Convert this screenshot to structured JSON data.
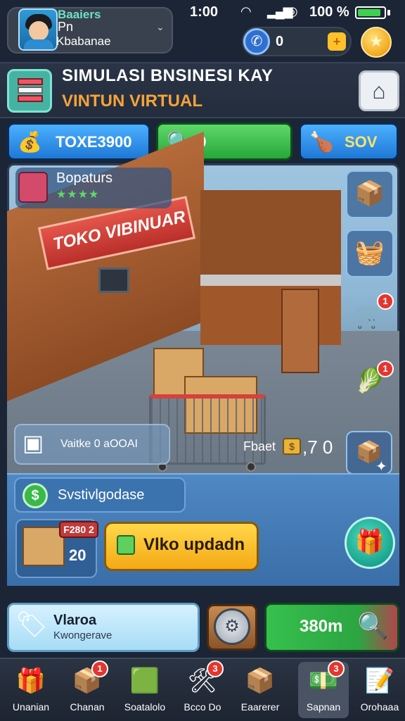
{
  "status_bar": {
    "time": "1:00",
    "battery_pct": "100 %",
    "battery_level": 0.8
  },
  "profile": {
    "line1": "Baaiers",
    "line2": "Pn",
    "line3": "Kbabanae"
  },
  "currency": {
    "value": "0"
  },
  "title": {
    "main": "SIMULASI BNSINESI KAY",
    "sub": "VINTUN VIRTUAL"
  },
  "stats": {
    "money": "TOXE3900",
    "search": "20",
    "third": "SOV"
  },
  "scene": {
    "info_title": "Bopaturs",
    "info_stars": "★★★★",
    "sign": "TOKO VIBINUAR",
    "item_text": "Vaitke 0 aOOAI",
    "price_label": "Fbaet",
    "price_value": ",7 0",
    "side_badges": [
      "1",
      "1"
    ]
  },
  "panel": {
    "sales_label": "Svstivlgodase",
    "stock_badge": "F280 2",
    "stock_value": "20",
    "upgrade_label": "Vlko updadn"
  },
  "actions": {
    "left_title": "Vlaroa",
    "left_sub": "Kwongerave",
    "right_value": "380m"
  },
  "nav": {
    "items": [
      {
        "label": "Unanian",
        "icon": "🎁",
        "badge": ""
      },
      {
        "label": "Chanan",
        "icon": "📦",
        "badge": "1"
      },
      {
        "label": "Soatalolo",
        "icon": "🟩",
        "badge": ""
      },
      {
        "label": "Bcco Do",
        "icon": "🛠",
        "badge": "3"
      },
      {
        "label": "Eaarerer",
        "icon": "📦",
        "badge": ""
      },
      {
        "label": "Sapnan",
        "icon": "💵",
        "badge": "3"
      },
      {
        "label": "Orohaaa",
        "icon": "📝",
        "badge": ""
      }
    ]
  },
  "colors": {
    "accent_orange": "#f7a33a",
    "money_blue": "#1e78d6",
    "green": "#27a83a",
    "upgrade_yellow": "#ffd74a"
  }
}
